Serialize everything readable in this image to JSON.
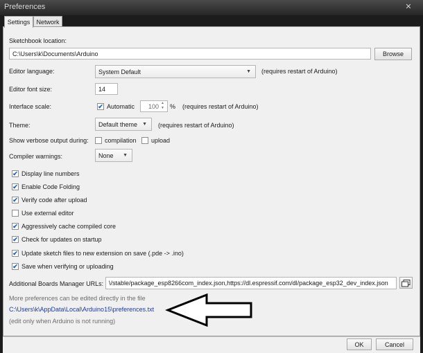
{
  "window": {
    "title": "Preferences",
    "close_glyph": "✕"
  },
  "tabs": [
    {
      "label": "Settings"
    },
    {
      "label": "Network"
    }
  ],
  "sketchbook": {
    "label": "Sketchbook location:",
    "value": "C:\\Users\\k\\Documents\\Arduino",
    "browse": "Browse"
  },
  "editor_language": {
    "label": "Editor language:",
    "value": "System Default",
    "note": "(requires restart of Arduino)"
  },
  "font_size": {
    "label": "Editor font size:",
    "value": "14"
  },
  "interface_scale": {
    "label": "Interface scale:",
    "auto_label": "Automatic",
    "value": "100",
    "unit": "%",
    "note": "(requires restart of Arduino)"
  },
  "theme": {
    "label": "Theme:",
    "value": "Default theme",
    "note": "(requires restart of Arduino)"
  },
  "verbose": {
    "label": "Show verbose output during:",
    "compilation": "compilation",
    "upload": "upload"
  },
  "compiler_warnings": {
    "label": "Compiler warnings:",
    "value": "None"
  },
  "options": [
    {
      "label": "Display line numbers",
      "checked": true
    },
    {
      "label": "Enable Code Folding",
      "checked": true
    },
    {
      "label": "Verify code after upload",
      "checked": true
    },
    {
      "label": "Use external editor",
      "checked": false
    },
    {
      "label": "Aggressively cache compiled core",
      "checked": true
    },
    {
      "label": "Check for updates on startup",
      "checked": true
    },
    {
      "label": "Update sketch files to new extension on save (.pde -> .ino)",
      "checked": true
    },
    {
      "label": "Save when verifying or uploading",
      "checked": true
    }
  ],
  "boards_urls": {
    "label": "Additional Boards Manager URLs:",
    "value": "\\/stable/package_esp8266com_index.json,https://dl.espressif.com/dl/package_esp32_dev_index.json"
  },
  "more_prefs": {
    "note": "More preferences can be edited directly in the file",
    "path": "C:\\Users\\k\\AppData\\Local\\Arduino15\\preferences.txt",
    "hint": "(edit only when Arduino is not running)"
  },
  "footer": {
    "ok": "OK",
    "cancel": "Cancel"
  },
  "check_glyph": "✔"
}
